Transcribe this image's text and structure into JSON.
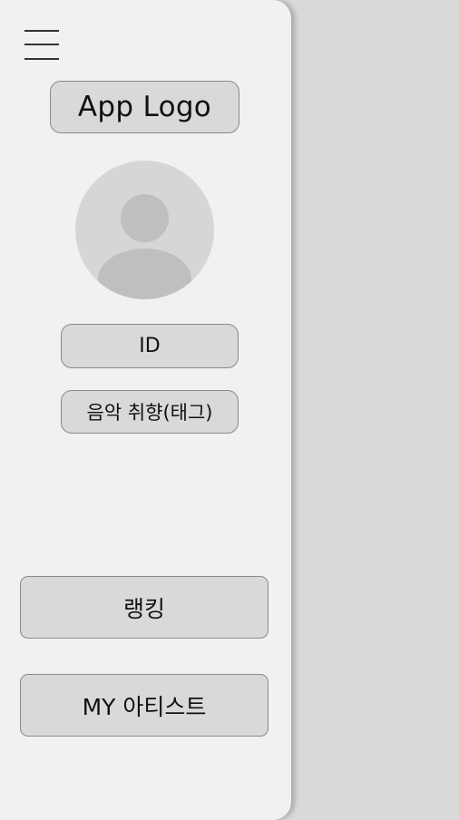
{
  "drawer": {
    "menu_icon": "hamburger-menu-icon",
    "logo_label": "App Logo",
    "avatar_icon": "user-avatar-placeholder-icon",
    "id_label": "ID",
    "tag_label": "음악 취향(태그)",
    "nav": {
      "ranking_label": "랭킹",
      "my_artist_label": "MY 아티스트"
    }
  },
  "colors": {
    "drawer_bg": "#f1f1f1",
    "page_bg": "#d9d9d9",
    "pill_bg": "#d9d9d9",
    "avatar_fg": "#bfbfbf"
  }
}
